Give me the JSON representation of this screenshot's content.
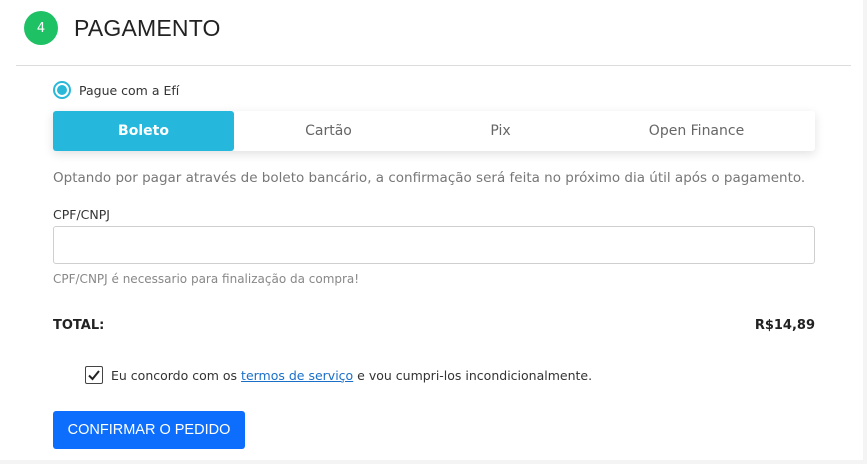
{
  "step": {
    "number": "4",
    "title": "PAGAMENTO",
    "badge_color": "#1ec264"
  },
  "payment_option": {
    "label": "Pague com a Efí",
    "selected": true
  },
  "tabs": [
    {
      "label": "Boleto",
      "active": true
    },
    {
      "label": "Cartão",
      "active": false
    },
    {
      "label": "Pix",
      "active": false
    },
    {
      "label": "Open Finance",
      "active": false
    }
  ],
  "boleto_info": "Optando por pagar através de boleto bancário, a confirmação será feita no próximo dia útil após o pagamento.",
  "cpf_field": {
    "label": "CPF/CNPJ",
    "value": "",
    "help": "CPF/CNPJ é necessario para finalização da compra!"
  },
  "total": {
    "label": "TOTAL:",
    "value": "R$14,89"
  },
  "agreement": {
    "checked": true,
    "prefix": "Eu concordo com os ",
    "link_text": "termos de serviço",
    "suffix": " e vou cumpri-los incondicionalmente."
  },
  "confirm_button": "CONFIRMAR O PEDIDO",
  "colors": {
    "accent": "#26b7dc",
    "primary_button": "#0d6efd",
    "link": "#1a6fc9"
  }
}
